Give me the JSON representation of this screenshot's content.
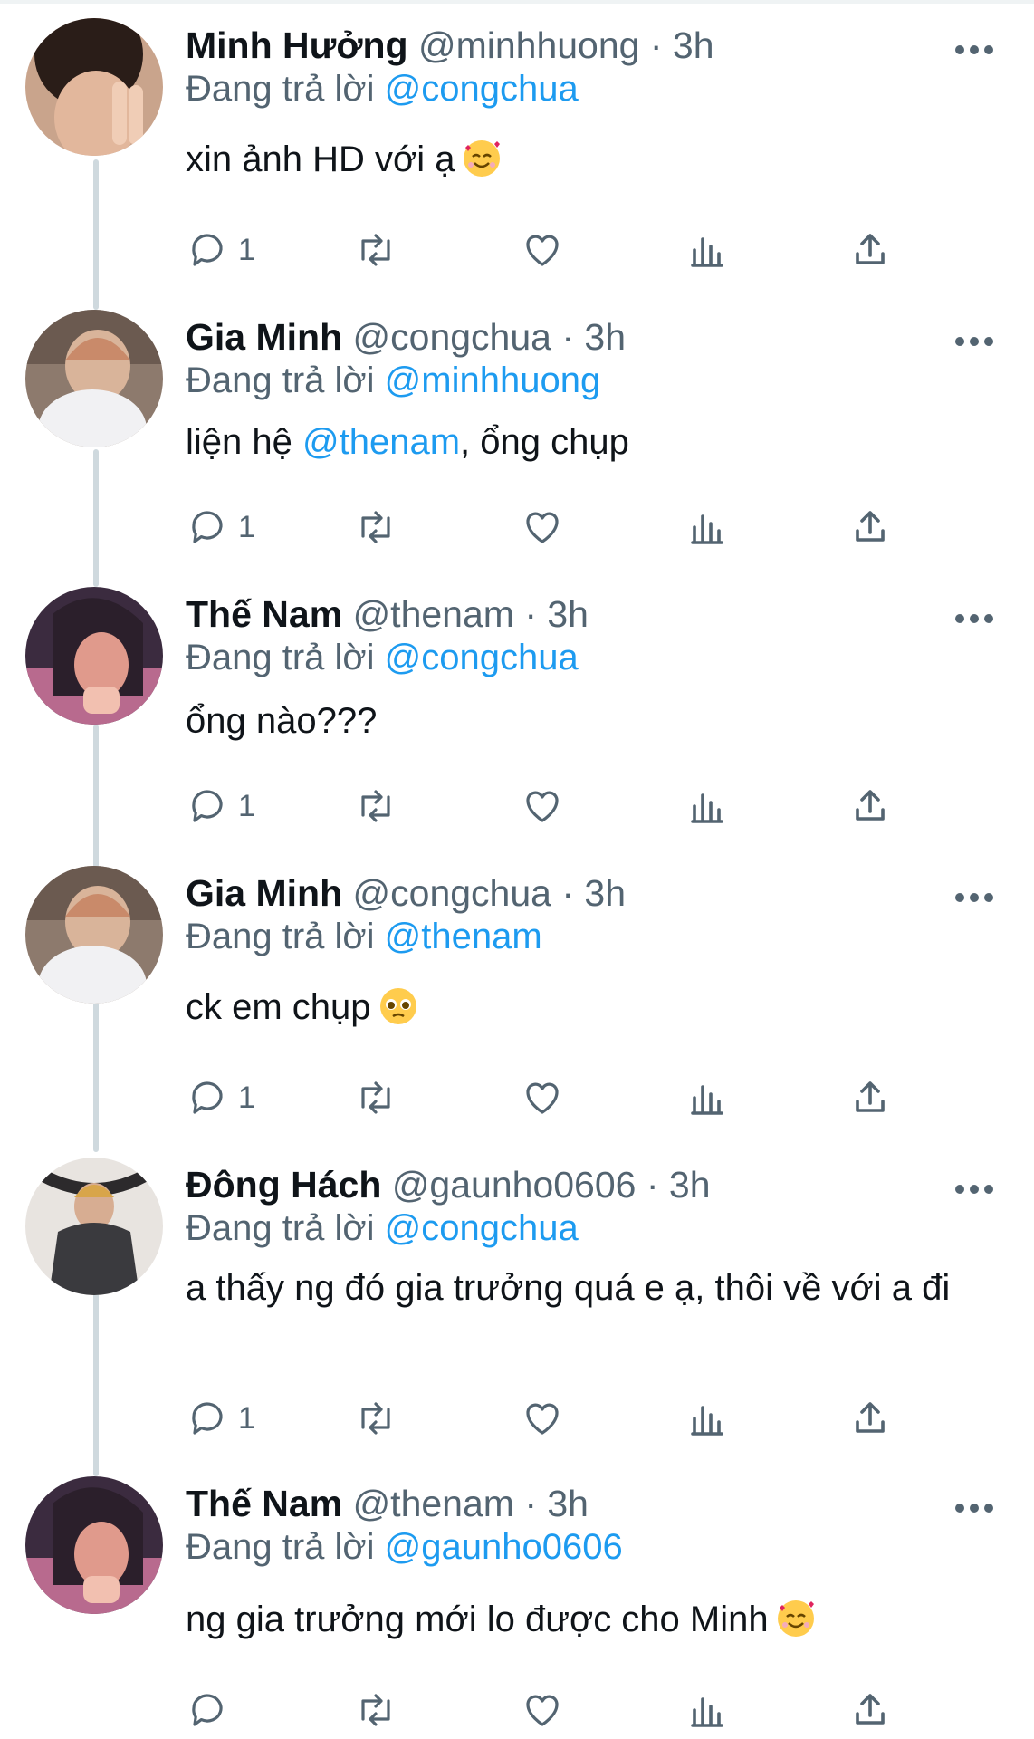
{
  "reply_prefix": "Đang trả lời",
  "accent_color": "#1d9bf0",
  "tweets": [
    {
      "name": "Minh Hưởng",
      "handle": "@minhhuong",
      "time": "3h",
      "replying_to": "@congchua",
      "text_parts": [
        {
          "t": "xin ảnh HD với ạ",
          "m": false
        }
      ],
      "emoji": "smiling-face-with-hearts",
      "reply_count": "1"
    },
    {
      "name": "Gia Minh",
      "handle": "@congchua",
      "time": "3h",
      "replying_to": "@minhhuong",
      "text_parts": [
        {
          "t": "liện hệ ",
          "m": false
        },
        {
          "t": "@thenam",
          "m": true
        },
        {
          "t": ", ổng chụp",
          "m": false
        }
      ],
      "emoji": "",
      "reply_count": "1"
    },
    {
      "name": "Thế Nam",
      "handle": "@thenam",
      "time": "3h",
      "replying_to": "@congchua",
      "text_parts": [
        {
          "t": "ổng nào???",
          "m": false
        }
      ],
      "emoji": "",
      "reply_count": "1"
    },
    {
      "name": "Gia Minh",
      "handle": "@congchua",
      "time": "3h",
      "replying_to": "@thenam",
      "text_parts": [
        {
          "t": "ck em chụp",
          "m": false
        }
      ],
      "emoji": "pleading-face",
      "reply_count": "1"
    },
    {
      "name": "Đông Hách",
      "handle": "@gaunho0606",
      "time": "3h",
      "replying_to": "@congchua",
      "text_parts": [
        {
          "t": "a thấy ng đó gia trưởng quá e ạ, thôi về với a đi",
          "m": false
        }
      ],
      "emoji": "",
      "reply_count": "1"
    },
    {
      "name": "Thế Nam",
      "handle": "@thenam",
      "time": "3h",
      "replying_to": "@gaunho0606",
      "text_parts": [
        {
          "t": "ng gia trưởng mới lo được cho Minh",
          "m": false
        }
      ],
      "emoji": "smiling-face-with-hearts",
      "reply_count": ""
    }
  ]
}
